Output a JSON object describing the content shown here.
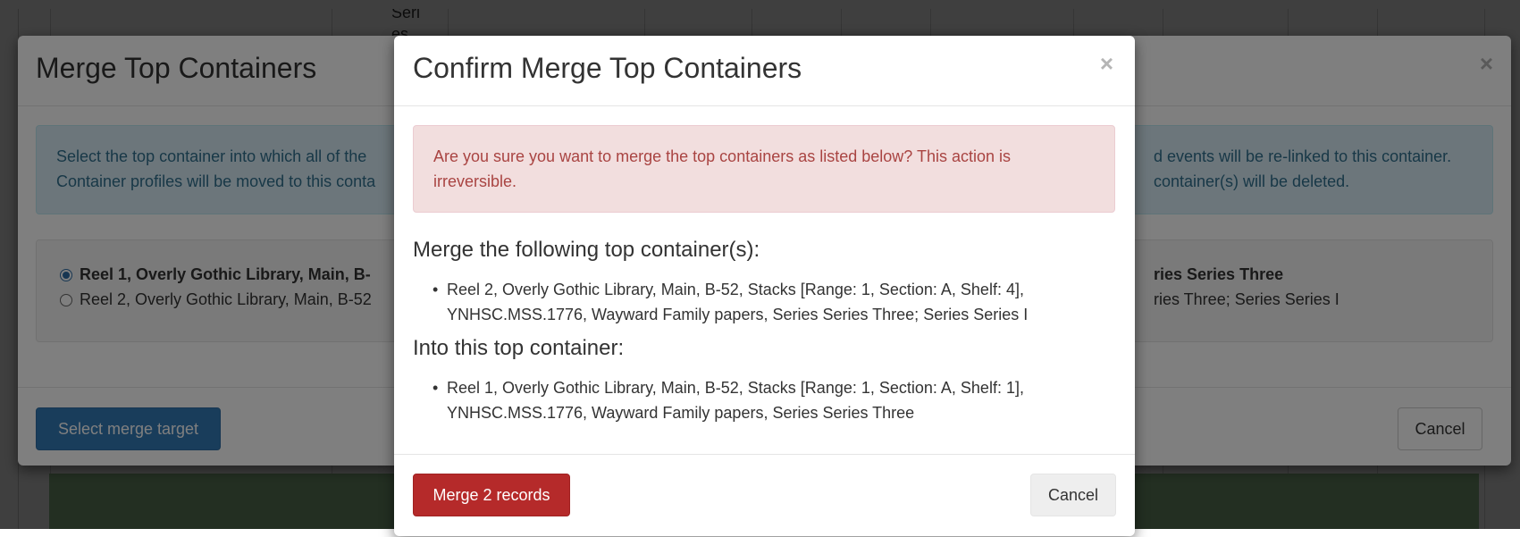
{
  "background": {
    "fragment_text_1": "Seri",
    "fragment_text_2": "es"
  },
  "outer_modal": {
    "title": "Merge Top Containers",
    "close_glyph": "×",
    "info": {
      "line1_left": "Select the top container into which all of the",
      "line2_left": "Container profiles will be moved to this conta",
      "line1_right": "d events will be re-linked to this container.",
      "line2_right": "container(s) will be deleted."
    },
    "options": [
      {
        "label_left": "Reel 1, Overly Gothic Library, Main, B-",
        "label_right": "ries Series Three",
        "selected": true
      },
      {
        "label_left": "Reel 2, Overly Gothic Library, Main, B-52",
        "label_right": "ries Three; Series Series I",
        "selected": false
      }
    ],
    "select_button": "Select merge target",
    "cancel_button": "Cancel"
  },
  "confirm_modal": {
    "title": "Confirm Merge Top Containers",
    "close_glyph": "×",
    "warning": "Are you sure you want to merge the top containers as listed below? This action is irreversible.",
    "merge_heading": "Merge the following top container(s):",
    "merge_items": [
      "Reel 2, Overly Gothic Library, Main, B-52, Stacks [Range: 1, Section: A, Shelf: 4], YNHSC.MSS.1776, Wayward Family papers, Series Series Three; Series Series I"
    ],
    "into_heading": "Into this top container:",
    "into_items": [
      "Reel 1, Overly Gothic Library, Main, B-52, Stacks [Range: 1, Section: A, Shelf: 1], YNHSC.MSS.1776, Wayward Family papers, Series Series Three"
    ],
    "merge_button": "Merge 2 records",
    "cancel_button": "Cancel"
  },
  "colors": {
    "primary": "#337ab7",
    "danger": "#b52a2a",
    "info_bg": "#d9edf7",
    "danger_bg": "#f2dede"
  }
}
